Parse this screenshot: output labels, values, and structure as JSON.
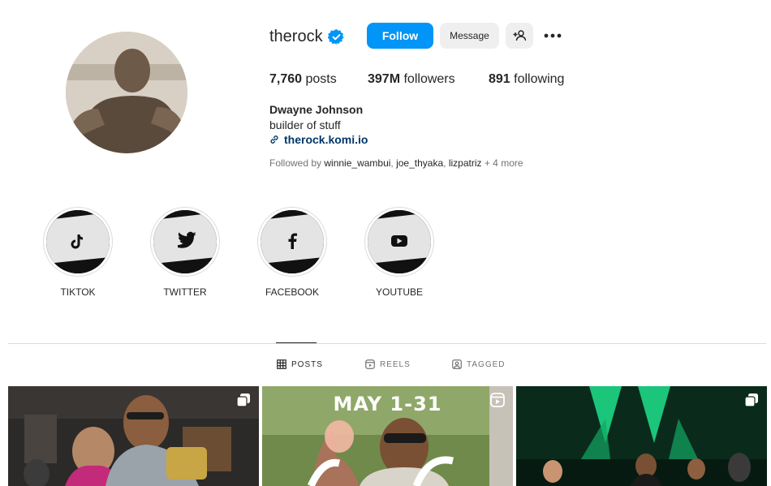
{
  "profile": {
    "username": "therock",
    "verified": true,
    "actions": {
      "follow_label": "Follow",
      "message_label": "Message",
      "add_user_icon": "add-user-icon",
      "more_icon": "more-dots-icon"
    },
    "stats": {
      "posts_count": "7,760",
      "posts_label": "posts",
      "followers_count": "397M",
      "followers_label": "followers",
      "following_count": "891",
      "following_label": "following"
    },
    "full_name": "Dwayne Johnson",
    "bio": "builder of stuff",
    "link": "therock.komi.io",
    "followed_by": {
      "prefix": "Followed by",
      "users": [
        "winnie_wambui",
        "joe_thyaka",
        "lizpatriz"
      ],
      "more": "+ 4 more"
    }
  },
  "highlights": [
    {
      "label": "TIKTOK",
      "icon": "tiktok-icon"
    },
    {
      "label": "TWITTER",
      "icon": "twitter-icon"
    },
    {
      "label": "FACEBOOK",
      "icon": "facebook-icon"
    },
    {
      "label": "YOUTUBE",
      "icon": "youtube-icon"
    }
  ],
  "tabs": [
    {
      "label": "POSTS",
      "icon": "grid-icon",
      "active": true
    },
    {
      "label": "REELS",
      "icon": "reels-icon",
      "active": false
    },
    {
      "label": "TAGGED",
      "icon": "tagged-icon",
      "active": false
    }
  ],
  "posts": [
    {
      "type": "carousel",
      "overlay_text": ""
    },
    {
      "type": "reel",
      "overlay_text": "MAY 1-31"
    },
    {
      "type": "carousel",
      "overlay_text": ""
    }
  ],
  "colors": {
    "accent": "#0095f6",
    "text": "#262626",
    "muted": "#737373",
    "link": "#00376b",
    "button_bg": "#efefef"
  }
}
